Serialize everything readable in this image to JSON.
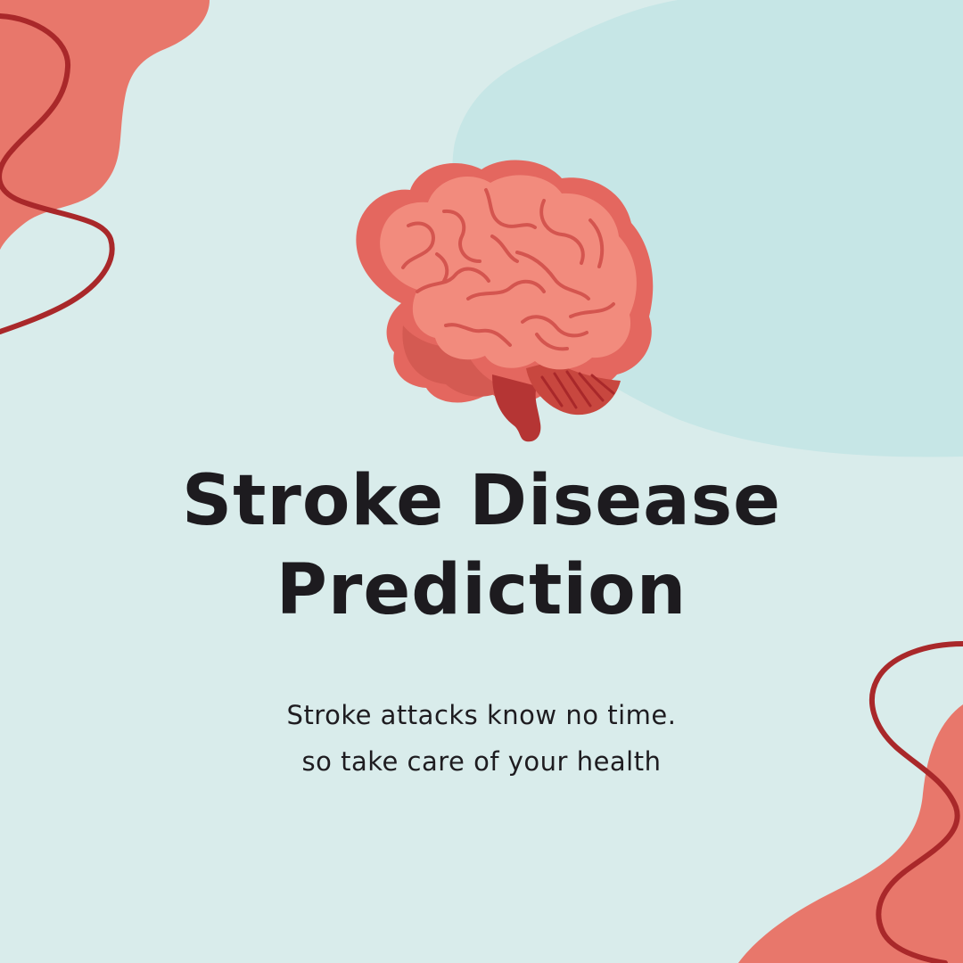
{
  "title": {
    "line1": "Stroke Disease",
    "line2": "Prediction"
  },
  "subtitle": {
    "line1": "Stroke attacks know no time.",
    "line2": "so take care of your health"
  },
  "illustration": {
    "icon": "brain-icon"
  },
  "colors": {
    "background": "#d9eceb",
    "teal_blob": "#c6e6e6",
    "coral_blob": "#e8776b",
    "dark_red_line": "#a9282a",
    "brain_light": "#f28b7d",
    "brain_mid": "#e4675f",
    "brain_shadow": "#d45a52",
    "brain_dark": "#b53534",
    "text": "#1d1b1f"
  }
}
